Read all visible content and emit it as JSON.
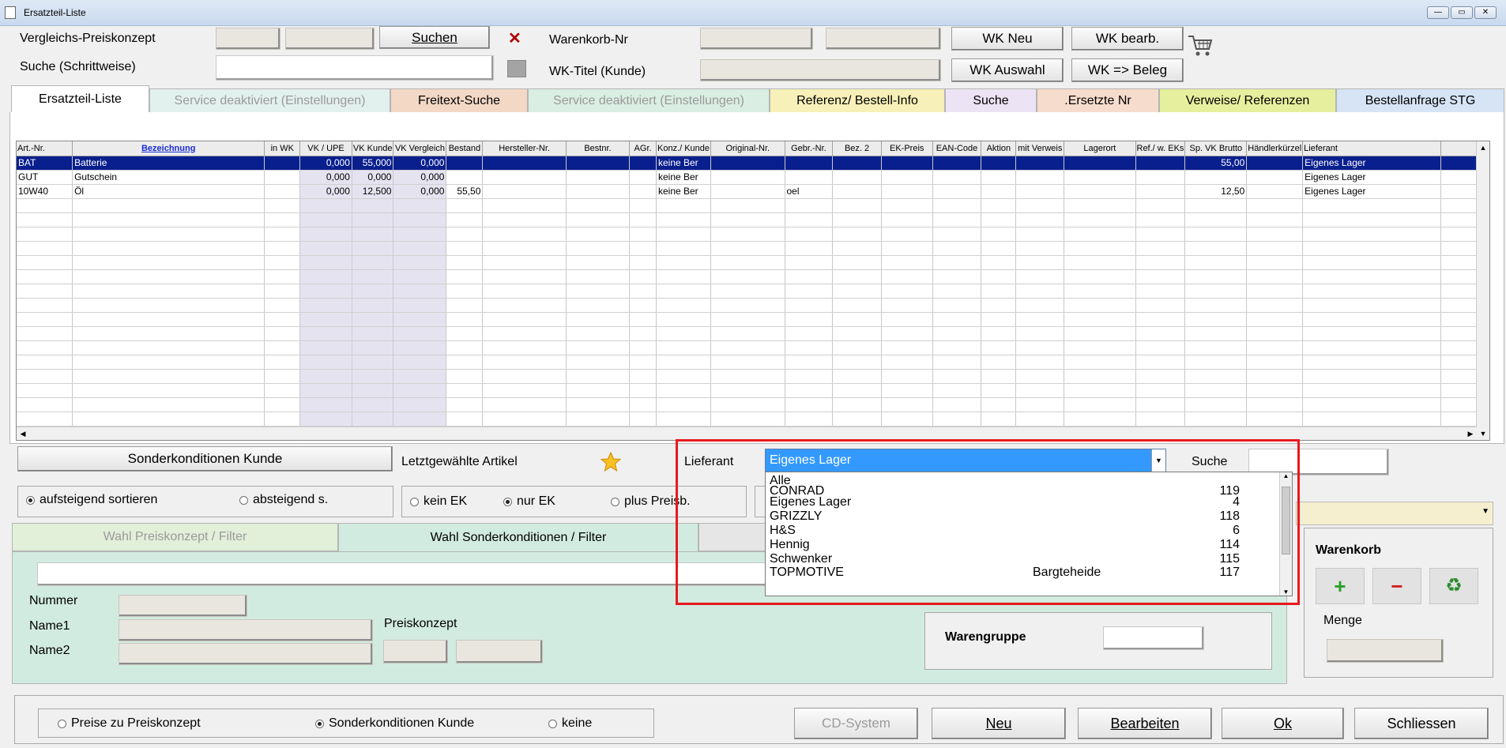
{
  "window": {
    "title": "Ersatzteil-Liste",
    "minimize": "—",
    "maximize": "▭",
    "close": "✕"
  },
  "top": {
    "vergleichs_label": "Vergleichs-Preiskonzept",
    "suche_label": "Suche (Schrittweise)",
    "suchen_btn": "Suchen",
    "clear_icon": "✕",
    "warenkorb_nr_label": "Warenkorb-Nr",
    "wk_titel_label": "WK-Titel (Kunde)",
    "wk_neu": "WK Neu",
    "wk_bearb": "WK bearb.",
    "wk_auswahl": "WK Auswahl",
    "wk_beleg": "WK => Beleg",
    "search_value": ""
  },
  "tabs": [
    {
      "label": "Ersatzteil-Liste"
    },
    {
      "label": "Service deaktiviert (Einstellungen)"
    },
    {
      "label": "Freitext-Suche"
    },
    {
      "label": "Service deaktiviert (Einstellungen)"
    },
    {
      "label": "Referenz/ Bestell-Info"
    },
    {
      "label": "Suche"
    },
    {
      "label": ".Ersetzte Nr"
    },
    {
      "label": "Verweise/ Referenzen"
    },
    {
      "label": "Bestellanfrage STG"
    }
  ],
  "grid": {
    "columns": [
      "Art.-Nr.",
      "Bezeichnung",
      "in WK",
      "VK / UPE",
      "VK Kunde",
      "VK Vergleich",
      "Bestand",
      "Hersteller-Nr.",
      "Bestnr.",
      "AGr.",
      "Konz./ Kunde",
      "Original-Nr.",
      "Gebr.-Nr.",
      "Bez. 2",
      "EK-Preis",
      "EAN-Code",
      "Aktion",
      "mit Verweis",
      "Lagerort",
      "Ref./ w. EKs",
      "Sp. VK Brutto",
      "Händlerkürzel",
      "Lieferant",
      ""
    ],
    "rows": [
      [
        "BAT",
        "Batterie",
        "",
        "0,000",
        "55,000",
        "0,000",
        "",
        "",
        "",
        "",
        "keine Ber",
        "",
        "",
        "",
        "",
        "",
        "",
        "",
        "",
        "",
        "55,00",
        "",
        "Eigenes Lager",
        ""
      ],
      [
        "GUT",
        "Gutschein",
        "",
        "0,000",
        "0,000",
        "0,000",
        "",
        "",
        "",
        "",
        "keine Ber",
        "",
        "",
        "",
        "",
        "",
        "",
        "",
        "",
        "",
        "",
        "",
        "Eigenes Lager",
        ""
      ],
      [
        "10W40",
        "Öl",
        "",
        "0,000",
        "12,500",
        "0,000",
        "55,50",
        "",
        "",
        "",
        "keine Ber",
        "",
        "oel",
        "",
        "",
        "",
        "",
        "",
        "",
        "",
        "12,50",
        "",
        "Eigenes Lager",
        ""
      ]
    ],
    "empty_rows": 17
  },
  "lower": {
    "sonderkonditionen_btn": "Sonderkonditionen Kunde",
    "letztgewaehlte": "Letztgewählte Artikel",
    "aufsteigend": "aufsteigend sortieren",
    "absteigend": "absteigend s.",
    "kein_ek": "kein EK",
    "nur_ek": "nur EK",
    "plus_preisb": "plus Preisb.",
    "subtab_preiskonzept": "Wahl Preiskonzept / Filter",
    "subtab_sonder": "Wahl Sonderkonditionen / Filter",
    "nummer": "Nummer",
    "name1": "Name1",
    "name2": "Name2",
    "preiskonzept": "Preiskonzept",
    "warengruppe": "Warengruppe",
    "warenkorb": "Warenkorb",
    "menge": "Menge",
    "plus_icon": "+",
    "minus_icon": "−",
    "recycle_icon": "♻"
  },
  "lieferant": {
    "label": "Lieferant",
    "selected": "Eigenes Lager",
    "suche_label": "Suche",
    "options": [
      {
        "name": "Alle",
        "count": ""
      },
      {
        "name": "CONRAD",
        "count": "119"
      },
      {
        "name": "Eigenes Lager",
        "count": "4"
      },
      {
        "name": "GRIZZLY",
        "count": "118"
      },
      {
        "name": "H&S",
        "count": "6"
      },
      {
        "name": "Hennig",
        "count": "114"
      },
      {
        "name": "Schwenker",
        "count": "115"
      },
      {
        "name": "TOPMOTIVE",
        "count": "117",
        "extra": "Bargteheide"
      }
    ]
  },
  "footer": {
    "preise_zu": "Preise zu Preiskonzept",
    "sonder_kunde": "Sonderkonditionen Kunde",
    "keine": "keine",
    "cd_system": "CD-System",
    "neu": "Neu",
    "bearbeiten": "Bearbeiten",
    "ok": "Ok",
    "schliessen": "Schliessen"
  },
  "colors": {
    "selection": "#0a1f8e",
    "dropdown_selected": "#3399ff",
    "highlight": "#e8191e"
  }
}
